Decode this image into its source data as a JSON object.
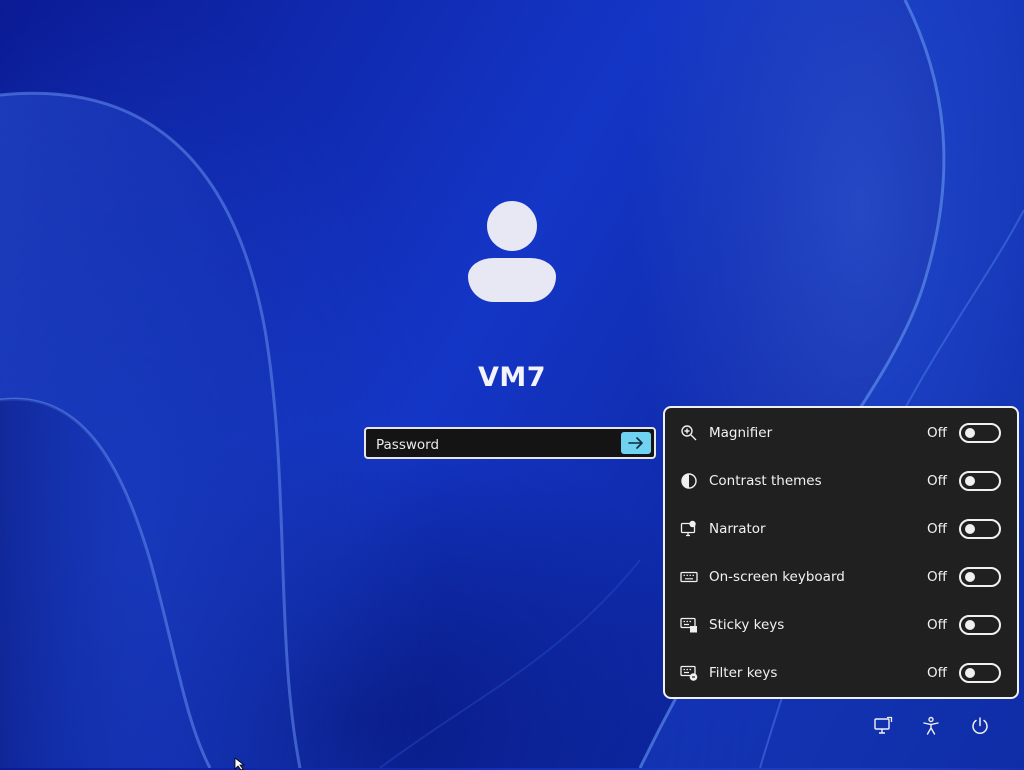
{
  "user": {
    "name": "VM7"
  },
  "login": {
    "password_placeholder": "Password",
    "submit_icon": "arrow-right-icon",
    "accent": "#6fd2f0"
  },
  "accessibility": {
    "items": [
      {
        "label": "Magnifier",
        "state": "Off",
        "icon": "magnifier-icon"
      },
      {
        "label": "Contrast themes",
        "state": "Off",
        "icon": "contrast-icon"
      },
      {
        "label": "Narrator",
        "state": "Off",
        "icon": "narrator-icon"
      },
      {
        "label": "On-screen keyboard",
        "state": "Off",
        "icon": "keyboard-icon"
      },
      {
        "label": "Sticky keys",
        "state": "Off",
        "icon": "sticky-keys-icon"
      },
      {
        "label": "Filter keys",
        "state": "Off",
        "icon": "filter-keys-icon"
      }
    ]
  },
  "bottom_bar": {
    "icons": [
      "network-icon",
      "accessibility-icon",
      "power-icon"
    ]
  },
  "colors": {
    "panel_bg": "#202020",
    "wallpaper": "#1436c6"
  }
}
